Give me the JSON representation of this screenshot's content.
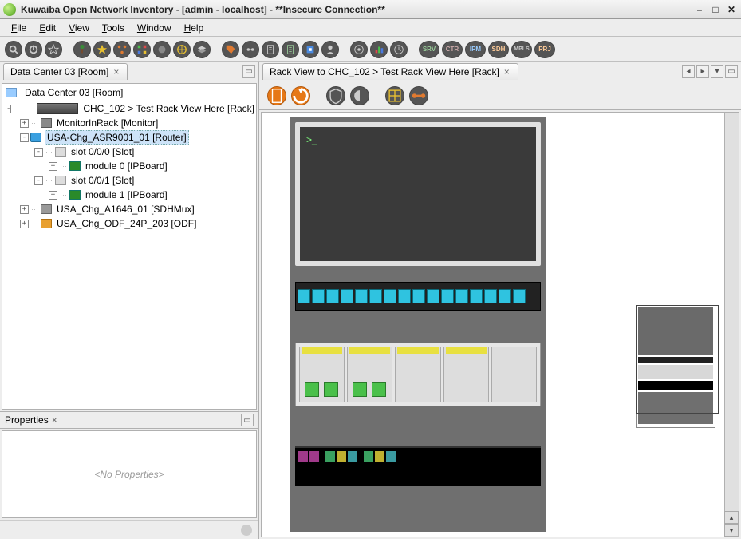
{
  "window": {
    "title": "Kuwaiba Open Network Inventory - [admin - localhost] - **Insecure Connection**"
  },
  "menu": {
    "file": "File",
    "edit": "Edit",
    "view": "View",
    "tools": "Tools",
    "window": "Window",
    "help": "Help"
  },
  "toolbar_labels": {
    "srv": "SRV",
    "ctr": "CTR",
    "ipm": "IPM",
    "sdh": "SDH",
    "mpls": "MPLS",
    "prj": "PRJ"
  },
  "left_tab": {
    "label": "Data Center 03 [Room]"
  },
  "tree": {
    "root": "Data Center 03 [Room]",
    "rack": "CHC_102 > Test Rack View Here [Rack]",
    "monitor": "MonitorInRack [Monitor]",
    "router": "USA-Chg_ASR9001_01 [Router]",
    "slot0": "slot 0/0/0 [Slot]",
    "module0": "module 0 [IPBoard]",
    "slot1": "slot 0/0/1 [Slot]",
    "module1": "module 1 [IPBoard]",
    "sdhmux": "USA_Chg_A1646_01 [SDHMux]",
    "odf": "USA_Chg_ODF_24P_203 [ODF]"
  },
  "properties": {
    "title": "Properties",
    "empty": "<No Properties>"
  },
  "right_tab": {
    "label": "Rack View to CHC_102 > Test Rack View Here [Rack]"
  },
  "rack_monitor": {
    "prompt": ">_"
  }
}
